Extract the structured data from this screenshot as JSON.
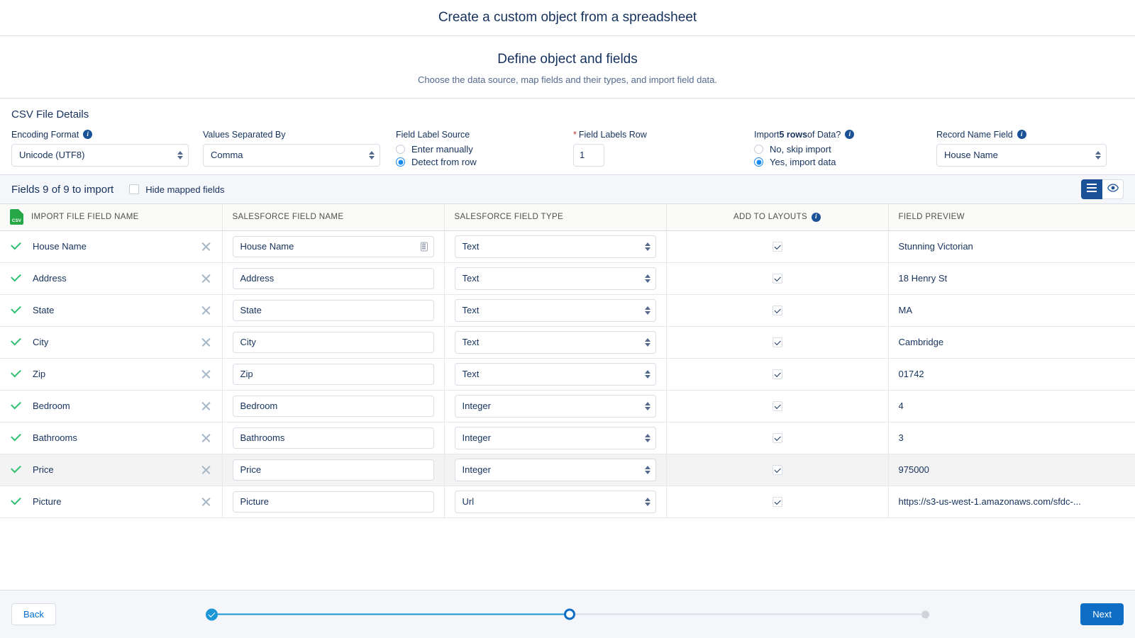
{
  "window": {
    "title": "Create a custom object from a spreadsheet"
  },
  "step": {
    "title": "Define object and fields",
    "subtitle": "Choose the data source, map fields and their types, and import field data."
  },
  "csv_panel": {
    "title": "CSV File Details",
    "encoding": {
      "label": "Encoding Format",
      "info_icon": "info-icon",
      "value": "Unicode (UTF8)"
    },
    "separator": {
      "label": "Values Separated By",
      "value": "Comma"
    },
    "field_label_source": {
      "label": "Field Label Source",
      "options": [
        {
          "label": "Enter manually",
          "selected": false
        },
        {
          "label": "Detect from row",
          "selected": true
        }
      ]
    },
    "field_labels_row": {
      "label": "Field Labels Row",
      "required_mark": "*",
      "value": "1"
    },
    "import_rows": {
      "label_prefix": "Import ",
      "label_bold": "5 rows",
      "label_suffix": " of Data?",
      "info_icon": "info-icon",
      "options": [
        {
          "label": "No, skip import",
          "selected": false
        },
        {
          "label": "Yes, import data",
          "selected": true
        }
      ]
    },
    "record_name_field": {
      "label": "Record Name Field",
      "info_icon": "info-icon",
      "value": "House Name"
    }
  },
  "fields_toolbar": {
    "count_text": "Fields 9 of 9 to import",
    "hide_mapped_label": "Hide mapped fields",
    "hide_mapped_checked": false,
    "view_buttons": [
      {
        "icon": "list-view-icon",
        "active": true
      },
      {
        "icon": "eye-preview-icon",
        "active": false
      }
    ]
  },
  "table": {
    "columns": [
      "IMPORT FILE FIELD NAME",
      "SALESFORCE FIELD NAME",
      "SALESFORCE FIELD TYPE",
      "ADD TO LAYOUTS",
      "FIELD PREVIEW"
    ],
    "source_icon": "csv-file-icon",
    "layouts_info_icon": "info-icon",
    "rows": [
      {
        "mapped": true,
        "import_name": "House Name",
        "sf_name": "House Name",
        "sf_type": "Text",
        "add_to_layouts": true,
        "preview": "Stunning Victorian",
        "record_name_badge": true,
        "highlighted": false
      },
      {
        "mapped": true,
        "import_name": "Address",
        "sf_name": "Address",
        "sf_type": "Text",
        "add_to_layouts": true,
        "preview": "18 Henry St",
        "record_name_badge": false,
        "highlighted": false
      },
      {
        "mapped": true,
        "import_name": "State",
        "sf_name": "State",
        "sf_type": "Text",
        "add_to_layouts": true,
        "preview": "MA",
        "record_name_badge": false,
        "highlighted": false
      },
      {
        "mapped": true,
        "import_name": "City",
        "sf_name": "City",
        "sf_type": "Text",
        "add_to_layouts": true,
        "preview": "Cambridge",
        "record_name_badge": false,
        "highlighted": false
      },
      {
        "mapped": true,
        "import_name": "Zip",
        "sf_name": "Zip",
        "sf_type": "Text",
        "add_to_layouts": true,
        "preview": "01742",
        "record_name_badge": false,
        "highlighted": false
      },
      {
        "mapped": true,
        "import_name": "Bedroom",
        "sf_name": "Bedroom",
        "sf_type": "Integer",
        "add_to_layouts": true,
        "preview": "4",
        "record_name_badge": false,
        "highlighted": false
      },
      {
        "mapped": true,
        "import_name": "Bathrooms",
        "sf_name": "Bathrooms",
        "sf_type": "Integer",
        "add_to_layouts": true,
        "preview": "3",
        "record_name_badge": false,
        "highlighted": false
      },
      {
        "mapped": true,
        "import_name": "Price",
        "sf_name": "Price",
        "sf_type": "Integer",
        "add_to_layouts": true,
        "preview": "975000",
        "record_name_badge": false,
        "highlighted": true
      },
      {
        "mapped": true,
        "import_name": "Picture",
        "sf_name": "Picture",
        "sf_type": "Url",
        "add_to_layouts": true,
        "preview": "https://s3-us-west-1.amazonaws.com/sfdc-...",
        "record_name_badge": false,
        "highlighted": false
      }
    ]
  },
  "footer": {
    "back_label": "Back",
    "next_label": "Next",
    "progress": [
      {
        "state": "done"
      },
      {
        "state": "current"
      },
      {
        "state": "todo"
      }
    ]
  },
  "colors": {
    "brand_blue": "#0d6ec4",
    "progress_blue": "#1b96d6",
    "success_green": "#2fbf71",
    "csv_green": "#27a745",
    "header_navy": "#16325c"
  }
}
